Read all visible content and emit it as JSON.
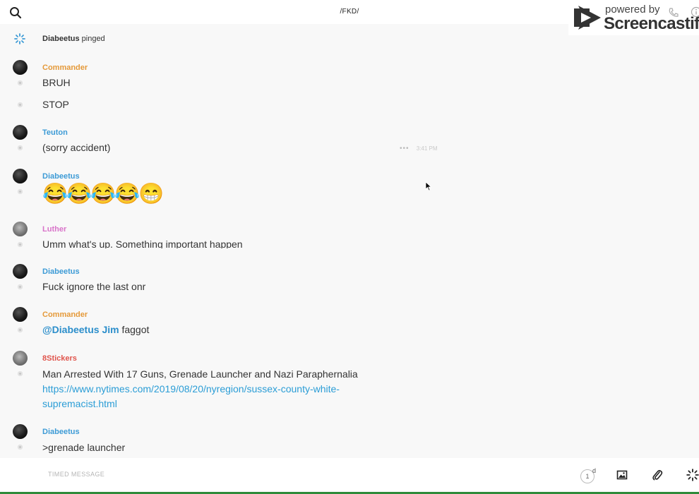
{
  "header": {
    "title": "/FKD/"
  },
  "watermark": {
    "line1": "powered by",
    "line2": "Screencastify"
  },
  "ping": {
    "author": "Diabeetus",
    "suffix": "pinged"
  },
  "messages": [
    {
      "author": "Commander",
      "color": "#e59a3a",
      "lines": [
        "BRUH",
        "STOP"
      ]
    },
    {
      "author": "Teuton",
      "color": "#3d9bd6",
      "lines": [
        "(sorry accident)"
      ],
      "timestamp": "3:41 PM"
    },
    {
      "author": "Diabeetus",
      "color": "#3d9bd6",
      "emoji": "😂😂😂😂😁"
    },
    {
      "author": "Luther",
      "color": "#d873c9",
      "lines": [
        "Umm what's up. Something important happen"
      ]
    },
    {
      "author": "Diabeetus",
      "color": "#3d9bd6",
      "lines": [
        "Fuck ignore the last onr"
      ]
    },
    {
      "author": "Commander",
      "color": "#e59a3a",
      "mention": "@Diabeetus Jim",
      "rest": " faggot"
    },
    {
      "author": "8Stickers",
      "color": "#e0554d",
      "lines": [
        "Man Arrested With 17 Guns, Grenade Launcher and Nazi Paraphernalia"
      ],
      "link_line1": "https://www.nytimes.com/2019/08/20/nyregion/sussex-county-white-",
      "link_line2": "supremacist.html"
    },
    {
      "author": "Diabeetus",
      "color": "#3d9bd6",
      "lines": [
        ">grenade launcher"
      ]
    }
  ],
  "composer": {
    "placeholder": "TIMED MESSAGE",
    "timer_value": "1",
    "timer_unit": "d"
  },
  "colors": {
    "accent_blue": "#2b9dd6",
    "bottom_bar": "#2e8b3a"
  }
}
